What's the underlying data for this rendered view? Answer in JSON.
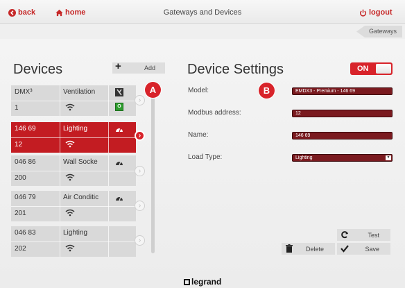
{
  "topbar": {
    "back_label": "back",
    "home_label": "home",
    "title": "Gateways and Devices",
    "logout_label": "logout"
  },
  "breadcrumb": {
    "label": "Gateways"
  },
  "devices_panel": {
    "title": "Devices",
    "add_label": "Add",
    "devices": [
      {
        "code": "DMX³",
        "type": "Ventilation",
        "address": "1",
        "status": "ok-badge",
        "status_text": "O"
      },
      {
        "code": "146 69",
        "type": "Lighting",
        "address": "12",
        "selected": true
      },
      {
        "code": "046 86",
        "type": "Wall Socke",
        "address": "200"
      },
      {
        "code": "046 79",
        "type": "Air Conditic",
        "address": "201"
      },
      {
        "code": "046 83",
        "type": "Lighting",
        "address": "202"
      }
    ]
  },
  "markers": {
    "a": "A",
    "b": "B"
  },
  "settings_panel": {
    "title": "Device Settings",
    "toggle_label": "ON",
    "fields": {
      "model_label": "Model:",
      "model_value": "EMDX3 - Premium - 146 69",
      "modbus_label": "Modbus address:",
      "modbus_value": "12",
      "name_label": "Name:",
      "name_value": "146 69",
      "load_label": "Load Type:",
      "load_value": "Lighting"
    },
    "test_label": "Test",
    "delete_label": "Delete",
    "save_label": "Save"
  },
  "footer": {
    "logo": "legrand"
  },
  "colors": {
    "accent": "#d8232a",
    "field_bg": "#7a1a1f",
    "panel": "#ececec"
  }
}
